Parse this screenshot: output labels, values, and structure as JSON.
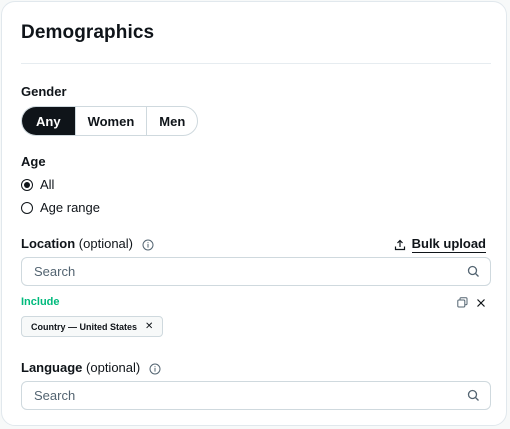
{
  "title": "Demographics",
  "gender": {
    "label": "Gender",
    "options": [
      "Any",
      "Women",
      "Men"
    ],
    "selected": "Any"
  },
  "age": {
    "label": "Age",
    "options": [
      "All",
      "Age range"
    ],
    "selected": "All"
  },
  "location": {
    "label": "Location",
    "optional": "(optional)",
    "bulk_upload": "Bulk upload",
    "search_placeholder": "Search",
    "include_label": "Include",
    "chips": [
      {
        "text": "Country — United States"
      }
    ]
  },
  "language": {
    "label": "Language",
    "optional": "(optional)",
    "search_placeholder": "Search"
  },
  "colors": {
    "accent": "#0f1419",
    "include": "#00ba7c",
    "border": "#cfd9de"
  }
}
